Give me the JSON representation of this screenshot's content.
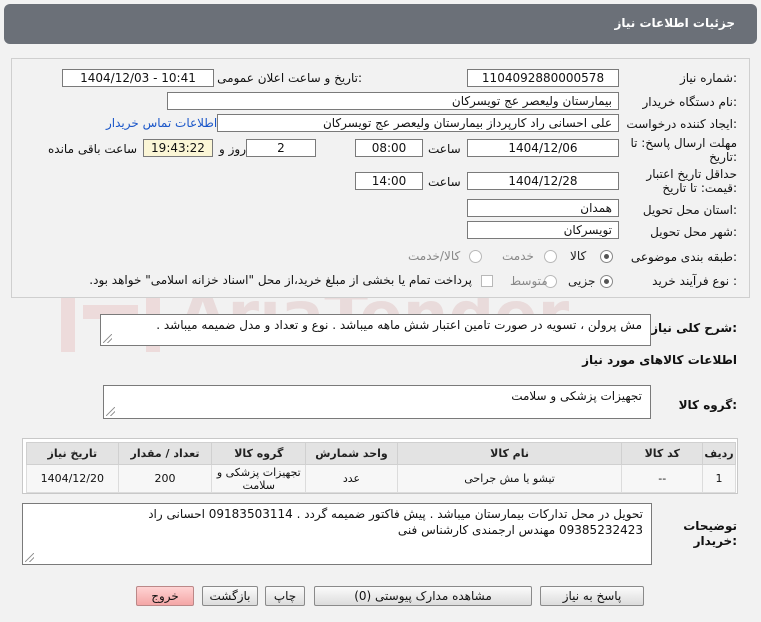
{
  "header": {
    "title": "جزئیات اطلاعات نیاز"
  },
  "form": {
    "need_number": {
      "label": "شماره نیاز:",
      "value": "1104092880000578"
    },
    "announce_datetime": {
      "label": "تاریخ و ساعت اعلان عمومی:",
      "value": "1404/12/03 - 10:41"
    },
    "buyer_org": {
      "label": "نام دستگاه خریدار:",
      "value": "بیمارستان ولیعصر  عج  تویسرکان"
    },
    "requester": {
      "label": "ایجاد کننده درخواست:",
      "value": "علی احسانی راد کارپرداز بیمارستان ولیعصر  عج  تویسرکان"
    },
    "contact_link": "اطلاعات تماس خریدار",
    "reply_deadline": {
      "label": "مهلت ارسال پاسخ: تا تاریخ:",
      "date": "1404/12/06",
      "time_label": "ساعت",
      "time": "08:00",
      "days": "2",
      "days_label": "روز و",
      "remaining": "19:43:22",
      "remaining_label": "ساعت باقی مانده"
    },
    "price_validity": {
      "label": "حداقل تاریخ اعتبار قیمت: تا تاریخ:",
      "date": "1404/12/28",
      "time_label": "ساعت",
      "time": "14:00"
    },
    "province": {
      "label": "استان محل تحویل:",
      "value": "همدان"
    },
    "city": {
      "label": "شهر محل تحویل:",
      "value": "تویسرکان"
    },
    "category": {
      "label": "طبقه بندی موضوعی:",
      "options": [
        "کالا",
        "خدمت",
        "کالا/خدمت"
      ],
      "selected": "کالا"
    },
    "purchase_type": {
      "label": "نوع فرآیند خرید :",
      "options": [
        "جزیی",
        "متوسط"
      ],
      "selected": "جزیی",
      "treasury_note": "پرداخت تمام یا بخشی از مبلغ خرید،از محل \"اسناد خزانه اسلامی\" خواهد بود."
    }
  },
  "general_description": {
    "label": "شرح کلی نیاز:",
    "value": "مش پرولن ، تسویه در صورت تامین اعتبار شش ماهه میباشد . نوع و تعداد و مدل ضمیمه میباشد ."
  },
  "goods_info": {
    "title": "اطلاعات کالاهای مورد نیاز",
    "group_label": "گروه کالا:",
    "group_value": "تجهیزات پزشکی و سلامت"
  },
  "table": {
    "headers": [
      "ردیف",
      "کد کالا",
      "نام کالا",
      "واحد شمارش",
      "گروه کالا",
      "تعداد / مقدار",
      "تاریخ نیاز"
    ],
    "rows": [
      [
        "1",
        "--",
        "تیشو یا مش جراحی",
        "عدد",
        "تجهیزات پزشکی و سلامت",
        "200",
        "1404/12/20"
      ]
    ]
  },
  "buyer_notes": {
    "label": "توضیحات خریدار:",
    "line1": "تحویل در محل تدارکات بیمارستان میباشد . پیش فاکتور ضمیمه گردد . 09183503114 احسانی راد",
    "line2": "09385232423 مهندس ارجمندی کارشناس فنی"
  },
  "buttons": {
    "reply": "پاسخ به نیاز",
    "attachments": "مشاهده مدارک پیوستی (0)",
    "print": "چاپ",
    "back": "بازگشت",
    "exit": "خروج"
  },
  "watermark": "AriaTender.net",
  "colors": {
    "header_bg": "#6b7078",
    "link": "#1a56c9",
    "exit_bg": "#f4a6a6",
    "remaining_bg": "#fbf6d6"
  }
}
